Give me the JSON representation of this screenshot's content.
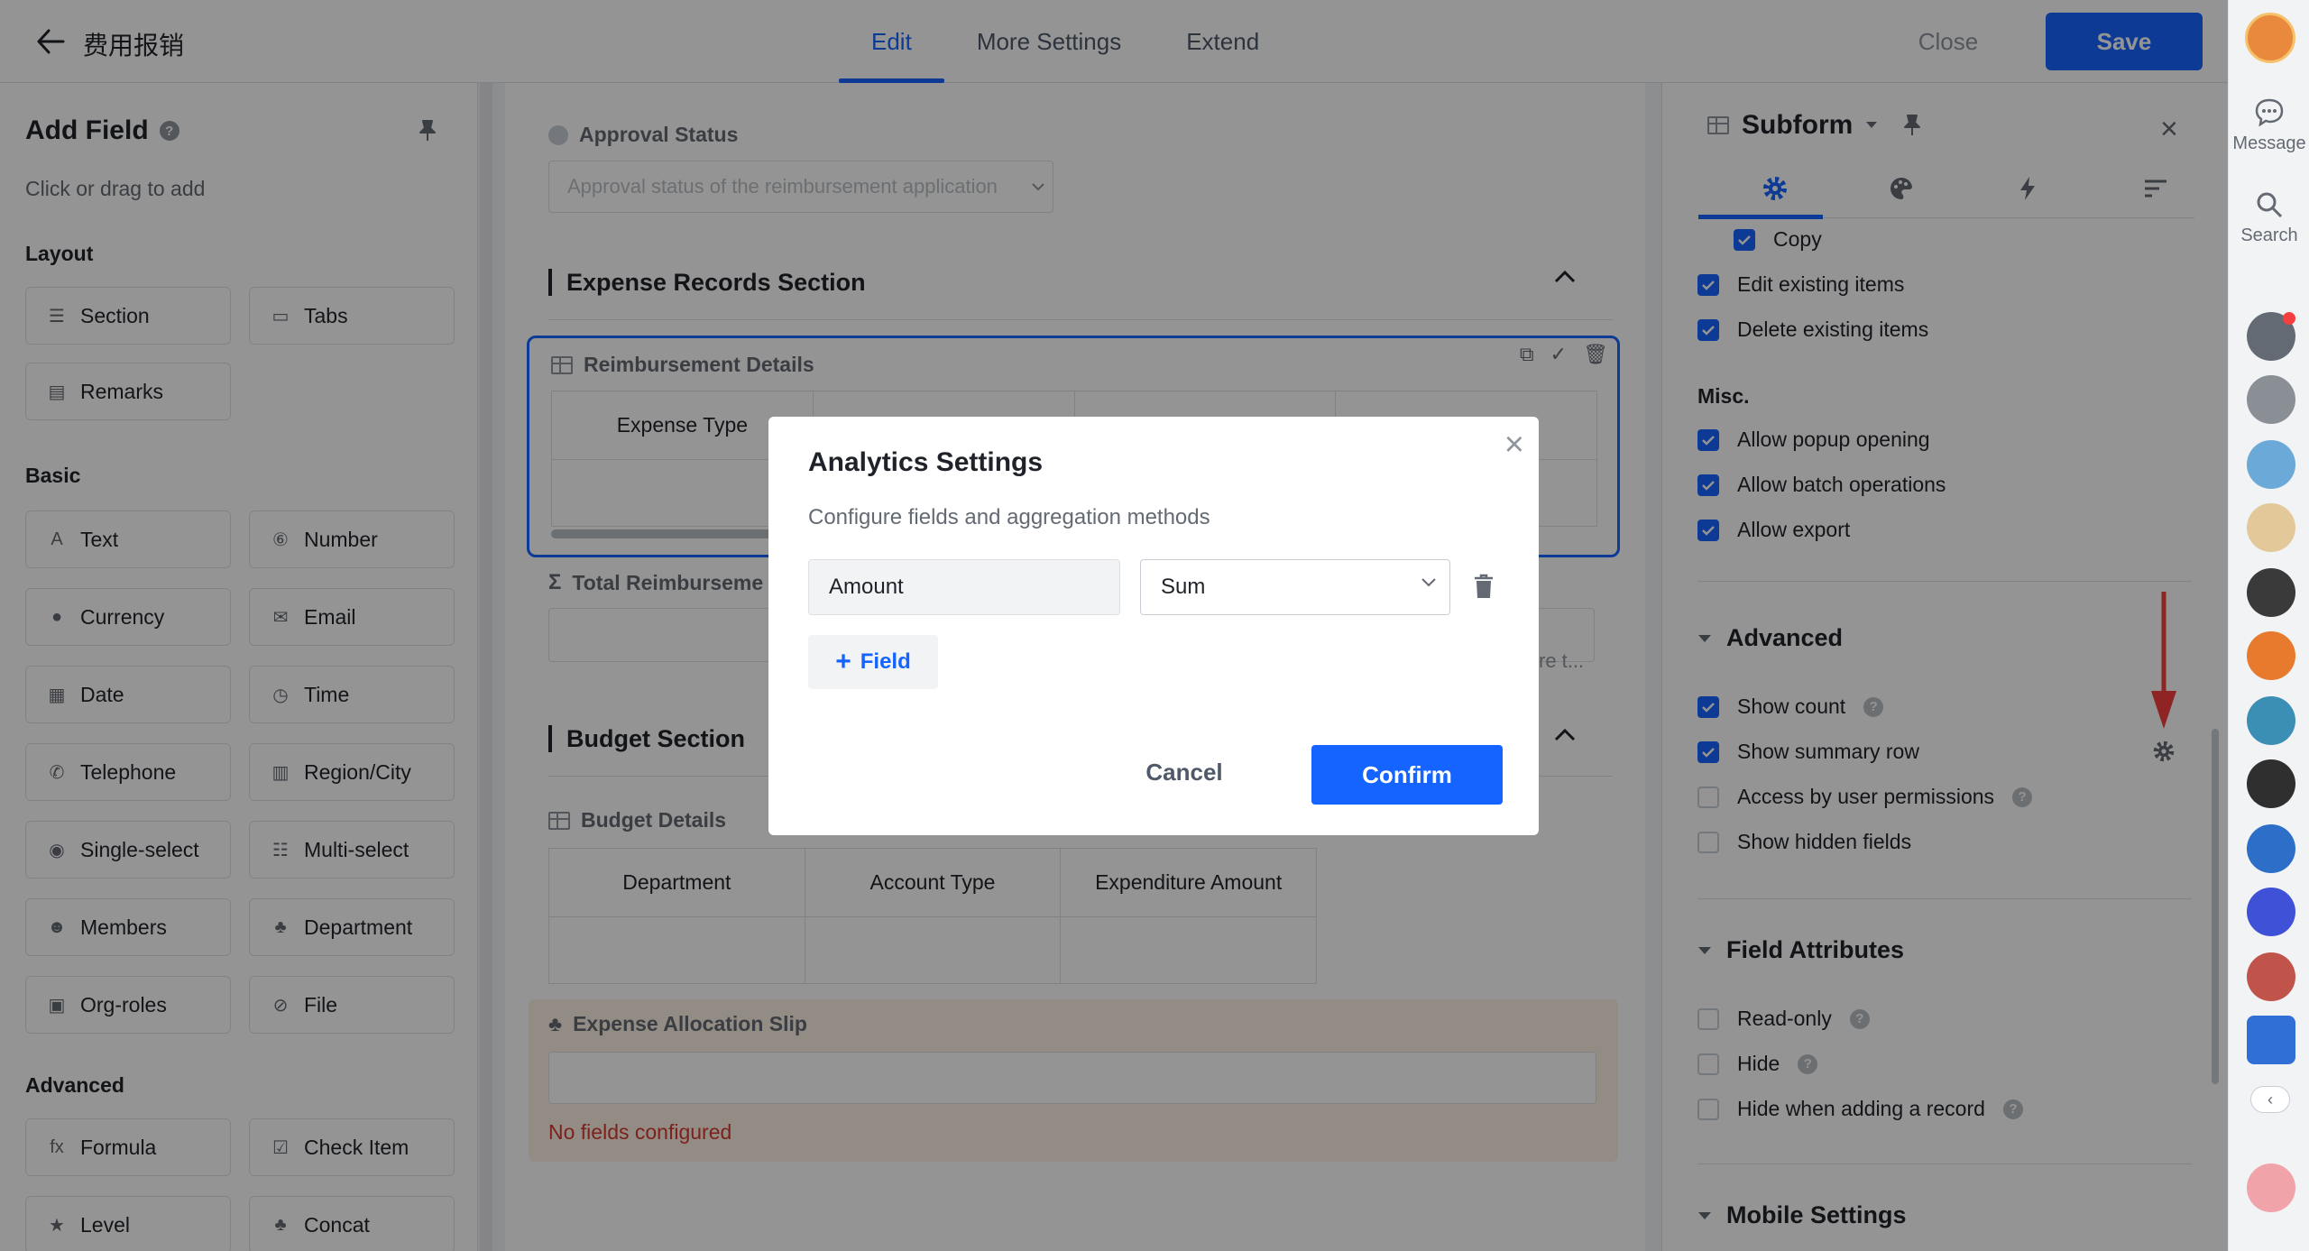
{
  "header": {
    "title": "费用报销",
    "tabs": [
      "Edit",
      "More Settings",
      "Extend"
    ],
    "active_tab": "Edit",
    "close_label": "Close",
    "save_label": "Save"
  },
  "left_panel": {
    "title": "Add Field",
    "subtitle": "Click or drag to add",
    "groups": {
      "layout": {
        "label": "Layout",
        "items": [
          "Section",
          "Tabs",
          "Remarks"
        ]
      },
      "basic": {
        "label": "Basic",
        "items": [
          "Text",
          "Number",
          "Currency",
          "Email",
          "Date",
          "Time",
          "Telephone",
          "Region/City",
          "Single-select",
          "Multi-select",
          "Members",
          "Department",
          "Org-roles",
          "File"
        ]
      },
      "advanced": {
        "label": "Advanced",
        "items": [
          "Formula",
          "Check Item",
          "Level",
          "Concat"
        ]
      }
    }
  },
  "form": {
    "approval_status_label": "Approval Status",
    "approval_status_placeholder": "Approval status of the reimbursement application",
    "expense_section_title": "Expense Records Section",
    "reimbursement_title": "Reimbursement Details",
    "reimbursement_col1": "Expense Type",
    "total_label": "Total Reimburseme",
    "truncated_hint": "re t...",
    "budget_section_title": "Budget Section",
    "budget_details_title": "Budget Details",
    "budget_columns": [
      "Department",
      "Account Type",
      "Expenditure Amount"
    ],
    "allocation_title": "Expense Allocation Slip",
    "allocation_message": "No fields configured"
  },
  "modal": {
    "title": "Analytics Settings",
    "description": "Configure fields and aggregation methods",
    "field_value": "Amount",
    "aggregation_value": "Sum",
    "add_field_label": "Field",
    "cancel_label": "Cancel",
    "confirm_label": "Confirm"
  },
  "props": {
    "title": "Subform",
    "permissions": [
      {
        "label": "Copy",
        "checked": true
      },
      {
        "label": "Edit existing items",
        "checked": true
      },
      {
        "label": "Delete existing items",
        "checked": true
      }
    ],
    "misc_label": "Misc.",
    "misc": [
      {
        "label": "Allow popup opening",
        "checked": true
      },
      {
        "label": "Allow batch operations",
        "checked": true
      },
      {
        "label": "Allow export",
        "checked": true
      }
    ],
    "advanced_label": "Advanced",
    "advanced": [
      {
        "label": "Show count",
        "checked": true
      },
      {
        "label": "Show summary row",
        "checked": true
      },
      {
        "label": "Access by user permissions",
        "checked": false
      },
      {
        "label": "Show hidden fields",
        "checked": false
      }
    ],
    "field_attributes_label": "Field Attributes",
    "field_attributes": [
      {
        "label": "Read-only",
        "checked": false
      },
      {
        "label": "Hide",
        "checked": false
      },
      {
        "label": "Hide when adding a record",
        "checked": false
      }
    ],
    "mobile_label": "Mobile Settings"
  },
  "sidebar": {
    "message_label": "Message",
    "search_label": "Search"
  },
  "colors": {
    "primary": "#1664ff",
    "danger": "#d83931",
    "arrow": "#f53f3f"
  }
}
